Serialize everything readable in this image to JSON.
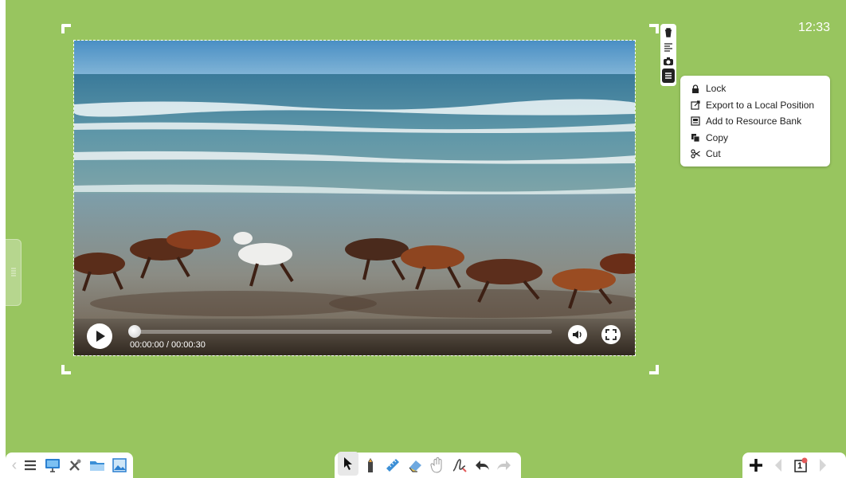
{
  "status": {
    "clock": "12:33"
  },
  "video": {
    "time_display": "00:00:00 / 00:00:30",
    "progress_fraction": 0.0
  },
  "side_tools": [
    "trash-icon",
    "text-format-icon",
    "camera-icon",
    "menu-icon"
  ],
  "context_menu": {
    "items": [
      {
        "label": "Lock",
        "icon": "lock-icon"
      },
      {
        "label": "Export to a Local Position",
        "icon": "export-icon"
      },
      {
        "label": "Add to Resource Bank",
        "icon": "resource-bank-icon"
      },
      {
        "label": "Copy",
        "icon": "copy-icon"
      },
      {
        "label": "Cut",
        "icon": "scissors-icon"
      }
    ]
  },
  "toolbars": {
    "left": [
      "chevron-left-icon",
      "menu-icon",
      "monitor-icon",
      "tools-icon",
      "folder-icon",
      "image-icon"
    ],
    "center": [
      "select-icon",
      "pen-icon",
      "ruler-icon",
      "eraser-icon",
      "hand-icon",
      "handwriting-icon",
      "undo-icon",
      "redo-icon"
    ],
    "right": [
      "add-page-icon",
      "prev-page-icon",
      "page-number-icon",
      "next-page-icon"
    ]
  },
  "page_indicator": {
    "value": "1"
  },
  "colors": {
    "background": "#98c55f",
    "menu_bg": "#ffffff"
  }
}
